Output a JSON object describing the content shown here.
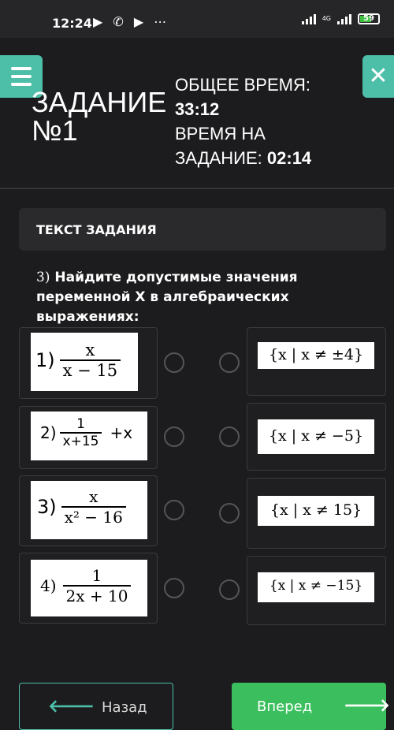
{
  "status_bar": {
    "time": "12:24",
    "battery": "59",
    "network": "4G"
  },
  "header": {
    "title_line1": "ЗАДАНИЕ",
    "title_line2": "№1",
    "total_time_label": "ОБЩЕЕ ВРЕМЯ:",
    "total_time_value": "33:12",
    "task_time_label_line1": "ВРЕМЯ НА",
    "task_time_label_line2": "ЗАДАНИЕ:",
    "task_time_value": "02:14"
  },
  "panel": {
    "heading": "ТЕКСТ ЗАДАНИЯ",
    "question_number": "3)",
    "question_text": "Найдите допустимые значения переменной X в алгебраических выражениях:"
  },
  "items": [
    {
      "label": "1)",
      "num": "x",
      "den": "x − 15",
      "extra": ""
    },
    {
      "label": "2)",
      "num": "1",
      "den": "x+15",
      "extra": "+x"
    },
    {
      "label": "3)",
      "num": "x",
      "den": "x² − 16",
      "extra": ""
    },
    {
      "label": "4)",
      "num": "1",
      "den": "2x + 10",
      "extra": ""
    }
  ],
  "answers": [
    "{x | x ≠ ±4}",
    "{x | x ≠ −5}",
    "{x | x ≠ 15}",
    "{x | x ≠ −15}"
  ],
  "footer": {
    "back_label": "Назад",
    "next_label": "Вперед"
  },
  "colors": {
    "accent": "#4dbfa8",
    "next_button": "#3bbf5e",
    "background": "#1c1c1e"
  }
}
